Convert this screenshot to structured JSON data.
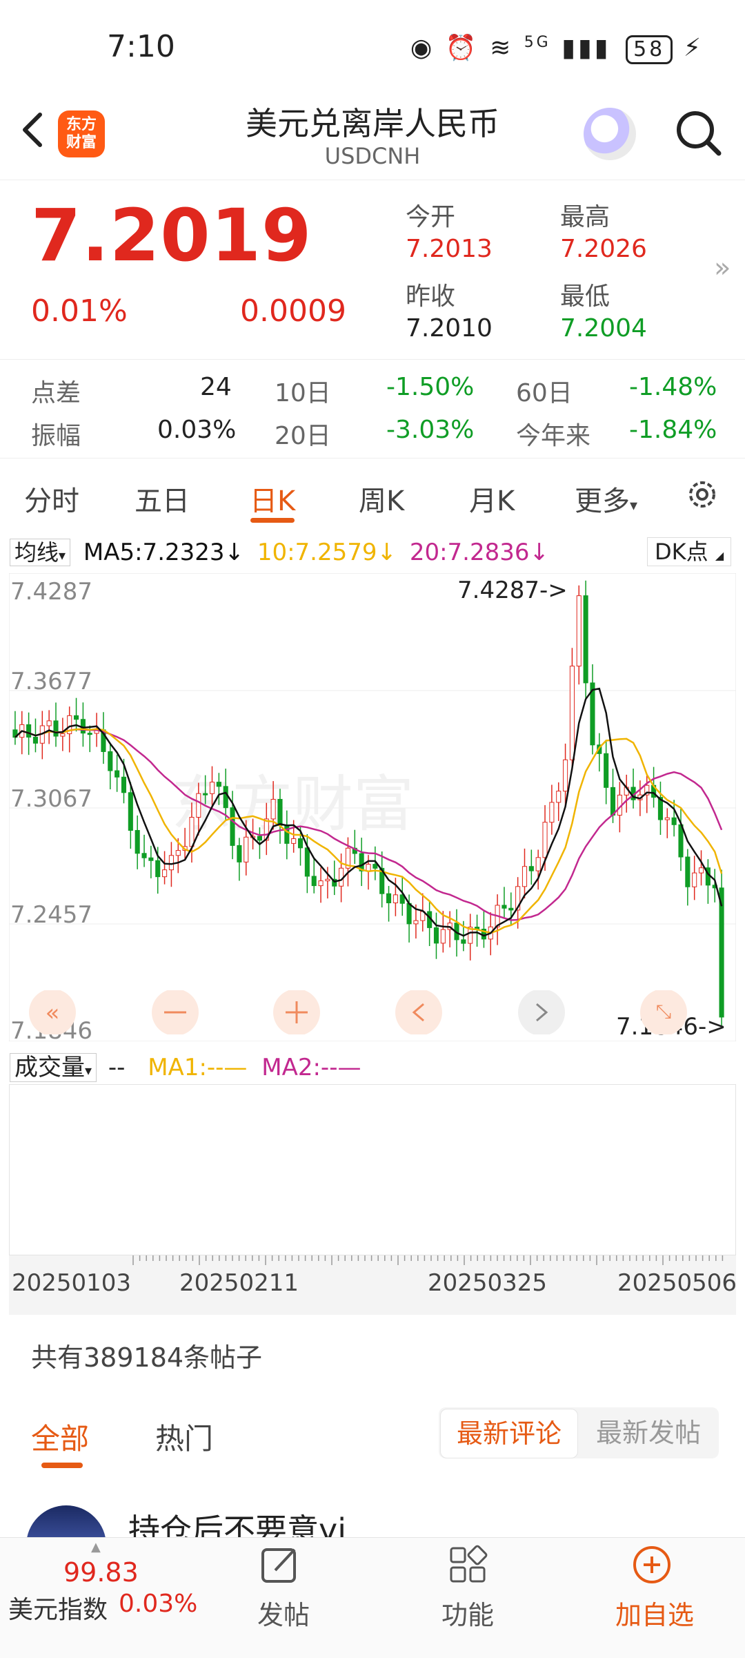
{
  "status": {
    "time": "7:10",
    "battery": "58",
    "network": "5G"
  },
  "header": {
    "title": "美元兑离岸人民币",
    "symbol": "USDCNH",
    "brand": "东方\n财富"
  },
  "quote": {
    "price": "7.2019",
    "change_pct": "0.01%",
    "change_abs": "0.0009",
    "open_label": "今开",
    "open": "7.2013",
    "high_label": "最高",
    "high": "7.2026",
    "prev_close_label": "昨收",
    "prev_close": "7.2010",
    "low_label": "最低",
    "low": "7.2004"
  },
  "stats": {
    "spread_label": "点差",
    "spread": "24",
    "amplitude_label": "振幅",
    "amplitude": "0.03%",
    "d10_label": "10日",
    "d10": "-1.50%",
    "d20_label": "20日",
    "d20": "-3.03%",
    "d60_label": "60日",
    "d60": "-1.48%",
    "ytd_label": "今年来",
    "ytd": "-1.84%"
  },
  "tabs": [
    {
      "label": "分时"
    },
    {
      "label": "五日"
    },
    {
      "label": "日K"
    },
    {
      "label": "周K"
    },
    {
      "label": "月K"
    },
    {
      "label": "更多"
    }
  ],
  "ma_legend": {
    "type": "均线",
    "ma5": "MA5:7.2323↓",
    "ma10": "10:7.2579↓",
    "ma20": "20:7.2836↓",
    "dk": "DK点"
  },
  "colors": {
    "up": "#e0281e",
    "down": "#0f9d25",
    "ma5": "#111111",
    "ma10": "#f0b400",
    "ma20": "#c2288f",
    "accent": "#e65a14"
  },
  "chart_data": {
    "type": "candlestick",
    "y_ticks": [
      "7.4287",
      "7.3677",
      "7.3067",
      "7.2457",
      "7.1846"
    ],
    "ylim": [
      7.1846,
      7.4287
    ],
    "max_annotation": "7.4287->",
    "min_annotation": "7.1846->",
    "x_ticks": [
      "20250103",
      "20250211",
      "20250325",
      "20250506"
    ]
  },
  "volume": {
    "type": "成交量",
    "dash": "--",
    "ma1": "MA1:--—",
    "ma2": "MA2:--—"
  },
  "posts": {
    "count_text": "共有389184条帖子",
    "tab_all": "全部",
    "tab_hot": "热门",
    "sort_comment": "最新评论",
    "sort_post": "最新发帖",
    "first_title": "持仓后不要意yi"
  },
  "bottom_nav": {
    "index_value": "99.83",
    "index_label": "美元指数",
    "index_pct": "0.03%",
    "post": "发帖",
    "functions": "功能",
    "add_watch": "加自选"
  }
}
